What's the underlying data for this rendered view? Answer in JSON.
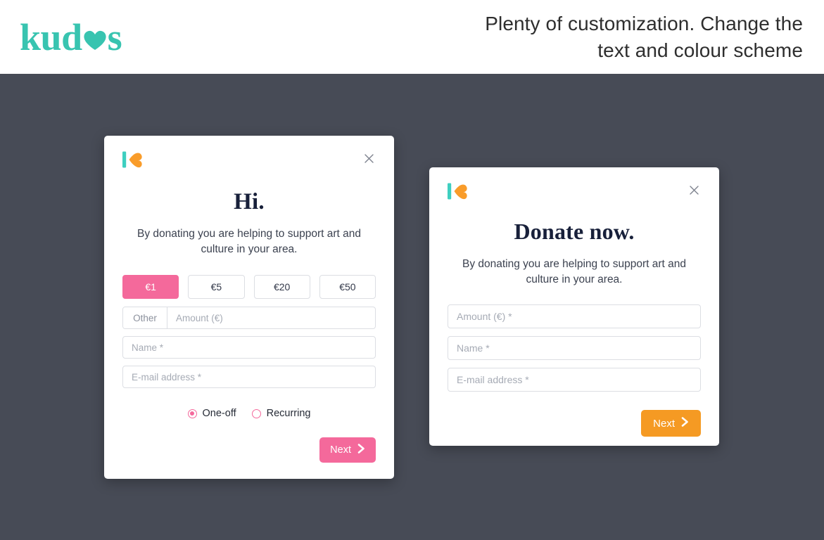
{
  "header": {
    "brand_text_before": "kud",
    "brand_heart_icon": "heart-icon",
    "brand_text_after": "s",
    "headline_line1": "Plenty of customization. Change the",
    "headline_line2": "text and colour scheme"
  },
  "colors": {
    "page_background": "#474b56",
    "brand_teal": "#38c4b0",
    "accent_pink": "#f4699b",
    "accent_orange": "#f59a23",
    "mark_teal": "#3ecfc0",
    "mark_orange": "#f99c2a",
    "heading_navy": "#18203a",
    "field_border": "#dcdee3",
    "placeholder_grey": "#a6abb5"
  },
  "left_card": {
    "logo_icon": "kudos-mark-icon",
    "close_icon": "close-icon",
    "close_label": "×",
    "title": "Hi.",
    "subtitle": "By donating you are helping to support art and culture in your area.",
    "amounts": [
      {
        "label": "€1",
        "selected": true
      },
      {
        "label": "€5",
        "selected": false
      },
      {
        "label": "€20",
        "selected": false
      },
      {
        "label": "€50",
        "selected": false
      }
    ],
    "other_prefix_label": "Other",
    "other_amount_placeholder": "Amount (€)",
    "other_amount_value": "",
    "name_placeholder": "Name *",
    "name_value": "",
    "email_placeholder": "E-mail address *",
    "email_value": "",
    "frequency": [
      {
        "label": "One-off",
        "checked": true
      },
      {
        "label": "Recurring",
        "checked": false
      }
    ],
    "next_label": "Next",
    "next_icon": "chevron-right-icon"
  },
  "right_card": {
    "logo_icon": "kudos-mark-icon",
    "close_icon": "close-icon",
    "close_label": "×",
    "title": "Donate now.",
    "subtitle": "By donating you are helping to support art and culture in your area.",
    "amount_placeholder": "Amount (€) *",
    "amount_value": "",
    "name_placeholder": "Name *",
    "name_value": "",
    "email_placeholder": "E-mail address *",
    "email_value": "",
    "next_label": "Next",
    "next_icon": "chevron-right-icon"
  }
}
